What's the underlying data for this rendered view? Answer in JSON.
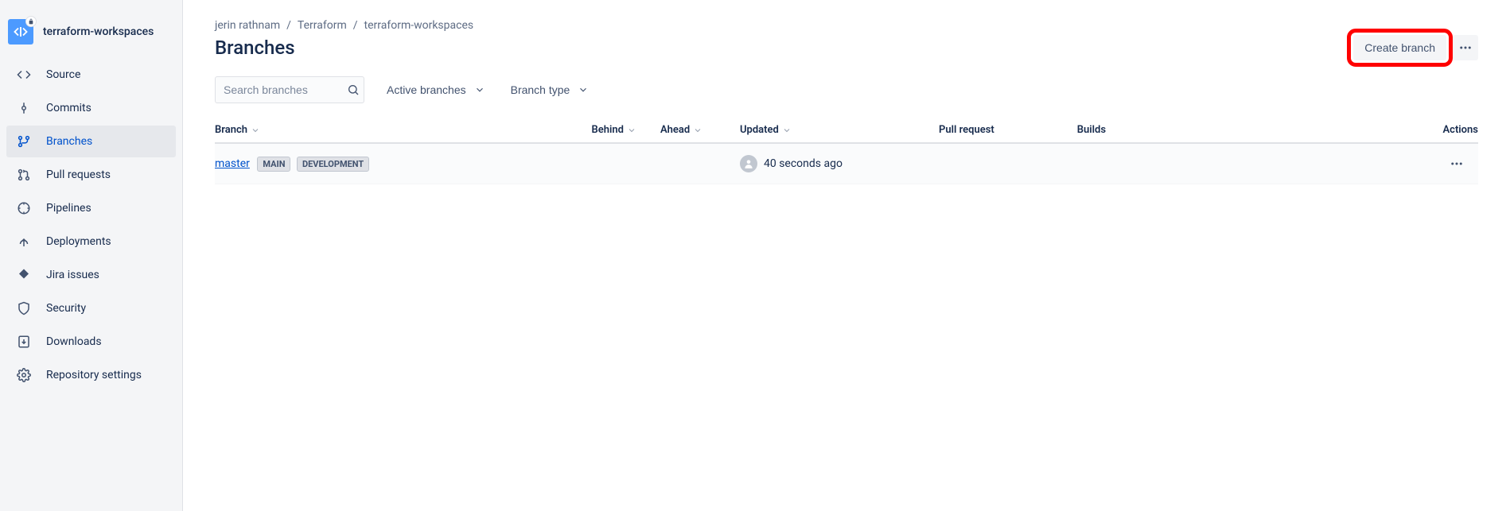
{
  "repo": {
    "name": "terraform-workspaces"
  },
  "sidebar": {
    "items": [
      {
        "label": "Source"
      },
      {
        "label": "Commits"
      },
      {
        "label": "Branches"
      },
      {
        "label": "Pull requests"
      },
      {
        "label": "Pipelines"
      },
      {
        "label": "Deployments"
      },
      {
        "label": "Jira issues"
      },
      {
        "label": "Security"
      },
      {
        "label": "Downloads"
      },
      {
        "label": "Repository settings"
      }
    ]
  },
  "breadcrumb": {
    "items": [
      "jerin rathnam",
      "Terraform",
      "terraform-workspaces"
    ]
  },
  "page": {
    "title": "Branches"
  },
  "actions": {
    "create": "Create branch"
  },
  "search": {
    "placeholder": "Search branches"
  },
  "filters": {
    "active": "Active branches",
    "type": "Branch type"
  },
  "table": {
    "headers": {
      "branch": "Branch",
      "behind": "Behind",
      "ahead": "Ahead",
      "updated": "Updated",
      "pr": "Pull request",
      "builds": "Builds",
      "actions": "Actions"
    },
    "rows": [
      {
        "name": "master",
        "tags": [
          "MAIN",
          "DEVELOPMENT"
        ],
        "updated": "40 seconds ago"
      }
    ]
  }
}
